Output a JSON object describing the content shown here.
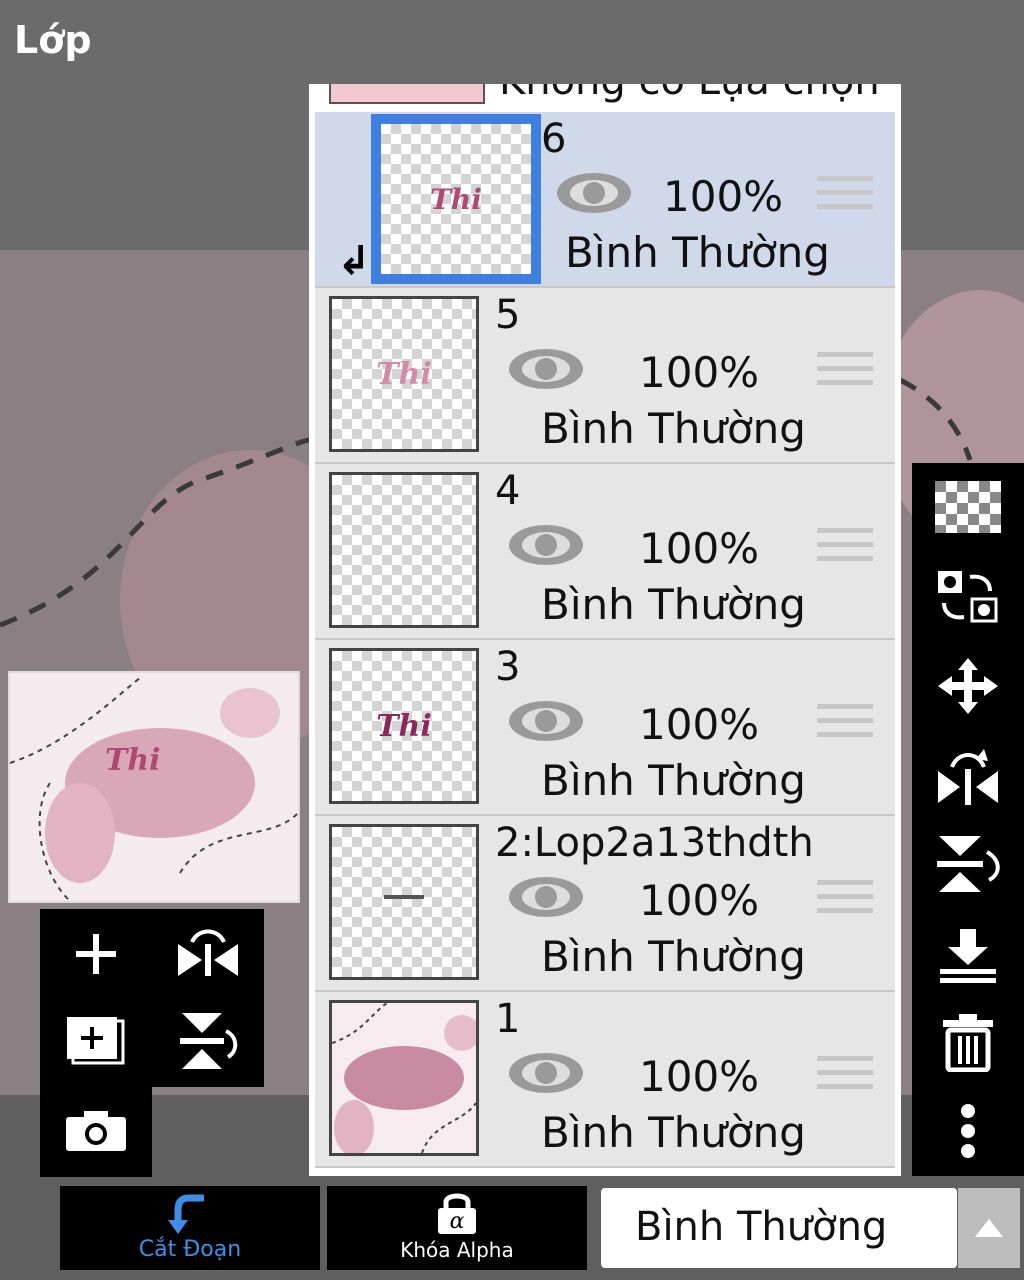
{
  "header": {
    "title": "Lớp"
  },
  "layers_panel": {
    "partial_top_label": "Không có Lựa chọn",
    "layers": [
      {
        "name": "6",
        "opacity": "100%",
        "blend": "Bình Thường",
        "selected": true,
        "clipped": true,
        "thumb_text": "Thi"
      },
      {
        "name": "5",
        "opacity": "100%",
        "blend": "Bình Thường",
        "selected": false,
        "thumb_text": "Thi"
      },
      {
        "name": "4",
        "opacity": "100%",
        "blend": "Bình Thường",
        "selected": false,
        "thumb_text": ""
      },
      {
        "name": "3",
        "opacity": "100%",
        "blend": "Bình Thường",
        "selected": false,
        "thumb_text": "Thi"
      },
      {
        "name": "2:Lop2a13thdth",
        "opacity": "100%",
        "blend": "Bình Thường",
        "selected": false,
        "thumb_text": ""
      },
      {
        "name": "1",
        "opacity": "100%",
        "blend": "Bình Thường",
        "selected": false,
        "thumb_text": ""
      }
    ]
  },
  "preview": {
    "text": "Thi"
  },
  "left_tools": [
    "add-layer",
    "flip-horizontal",
    "add-layer-copy",
    "flip-vertical",
    "camera"
  ],
  "right_tools": [
    "transparency",
    "swap-layers",
    "move",
    "flip-horizontal",
    "flip-vertical",
    "merge-down",
    "delete",
    "more"
  ],
  "bottom": {
    "clip_label": "Cắt Đoạn",
    "alpha_lock_label": "Khóa Alpha",
    "blend_mode": "Bình Thường"
  },
  "colors": {
    "selected_row": "#cfd9ea",
    "selected_border": "#3f7fe0",
    "accent_blue": "#3f8fe8"
  }
}
